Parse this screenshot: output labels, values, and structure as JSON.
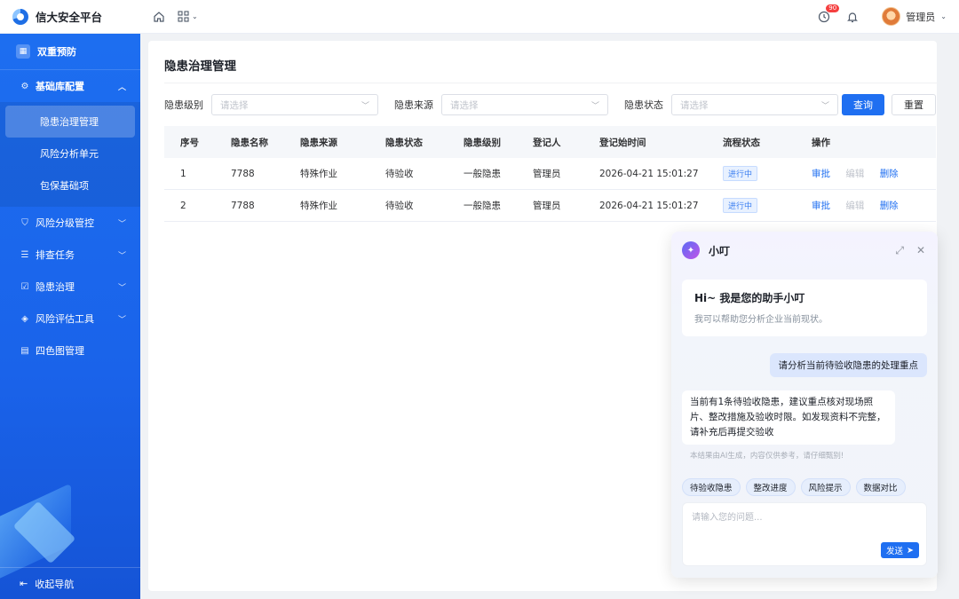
{
  "app": {
    "title": "信大安全平台"
  },
  "header": {
    "notification_count": "90",
    "user_name": "管理员"
  },
  "sidebar": {
    "section_title": "双重预防",
    "groups": [
      {
        "label": "基础库配置",
        "icon": "gear-icon",
        "expanded": true,
        "items": [
          {
            "label": "隐患治理管理",
            "active": true
          },
          {
            "label": "风险分析单元"
          },
          {
            "label": "包保基础项"
          }
        ]
      },
      {
        "label": "风险分级管控",
        "icon": "shield-icon"
      },
      {
        "label": "排查任务",
        "icon": "list-icon"
      },
      {
        "label": "隐患治理",
        "icon": "checkbox-icon"
      },
      {
        "label": "风险评估工具",
        "icon": "layers-icon"
      },
      {
        "label": "四色图管理",
        "icon": "grid-icon"
      }
    ],
    "footer_label": "收起导航"
  },
  "main": {
    "page_title": "隐患治理管理",
    "filters": [
      {
        "label": "隐患级别",
        "placeholder": "请选择"
      },
      {
        "label": "隐患来源",
        "placeholder": "请选择"
      },
      {
        "label": "隐患状态",
        "placeholder": "请选择"
      }
    ],
    "query_button": "查询",
    "reset_button": "重置",
    "table": {
      "columns": [
        "序号",
        "隐患名称",
        "隐患来源",
        "隐患状态",
        "隐患级别",
        "登记人",
        "登记始时间",
        "流程状态",
        "操作"
      ],
      "rows": [
        [
          "1",
          "7788",
          "特殊作业",
          "待验收",
          "一般隐患",
          "管理员",
          "2026-04-21 15:01:27",
          "进行中"
        ],
        [
          "2",
          "7788",
          "特殊作业",
          "待验收",
          "一般隐患",
          "管理员",
          "2026-04-21 15:01:27",
          "进行中"
        ]
      ],
      "actions": [
        "审批",
        "编辑",
        "删除"
      ]
    }
  },
  "chat": {
    "title": "小叮",
    "welcome_title": "Hi~ 我是您的助手小叮",
    "welcome_sub": "我可以帮助您分析企业当前现状。",
    "user_message": "请分析当前待验收隐患的处理重点",
    "bot_message": "当前有1条待验收隐患，建议重点核对现场照片、整改措施及验收时限。如发现资料不完整，请补充后再提交验收",
    "disclaimer": "本结果由AI生成，内容仅供参考，请仔细甄别!",
    "chips": [
      "待验收隐患",
      "整改进度",
      "风险提示",
      "数据对比"
    ],
    "input_placeholder": "请输入您的问题...",
    "send_label": "发送"
  },
  "colors": {
    "primary": "#1f6ff1",
    "sidebar": "#1d6ef0",
    "danger": "#f53f3f"
  }
}
